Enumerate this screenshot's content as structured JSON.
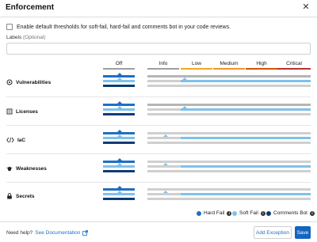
{
  "header": {
    "title": "Enforcement",
    "close_icon": "close-icon"
  },
  "default_thresholds": {
    "label": "Enable default thresholds for soft-fail, hard-fail and comments bot in your code reviews.",
    "checked": false
  },
  "labels_field": {
    "label": "Labels",
    "optional": "(Optional)",
    "value": "",
    "placeholder": ""
  },
  "columns": {
    "off": {
      "label": "Off",
      "color": "#9e9e9e"
    },
    "info": {
      "label": "Info",
      "color": "#9e9e9e"
    },
    "low": {
      "label": "Low",
      "color": "#f5a623"
    },
    "medium": {
      "label": "Medium",
      "color": "#f0932b"
    },
    "high": {
      "label": "High",
      "color": "#d35400"
    },
    "critical": {
      "label": "Critical",
      "color": "#b83232"
    }
  },
  "rows": [
    {
      "label": "Vulnerabilities",
      "icon": "gear-icon"
    },
    {
      "label": "Licenses",
      "icon": "document-icon"
    },
    {
      "label": "IaC",
      "icon": "code-icon"
    },
    {
      "label": "Weaknesses",
      "icon": "bug-icon"
    },
    {
      "label": "Secrets",
      "icon": "lock-icon"
    }
  ],
  "legend": {
    "hard_fail": {
      "label": "Hard Fail",
      "color": "#1f6fc5"
    },
    "soft_fail": {
      "label": "Soft Fail",
      "color": "#7fc1ea"
    },
    "comments_bot": {
      "label": "Comments Bot",
      "color": "#0d3b78"
    }
  },
  "footer": {
    "help_text": "Need help?",
    "help_link": "See Documentation",
    "add_exception": "Add Exception",
    "save": "Save"
  }
}
